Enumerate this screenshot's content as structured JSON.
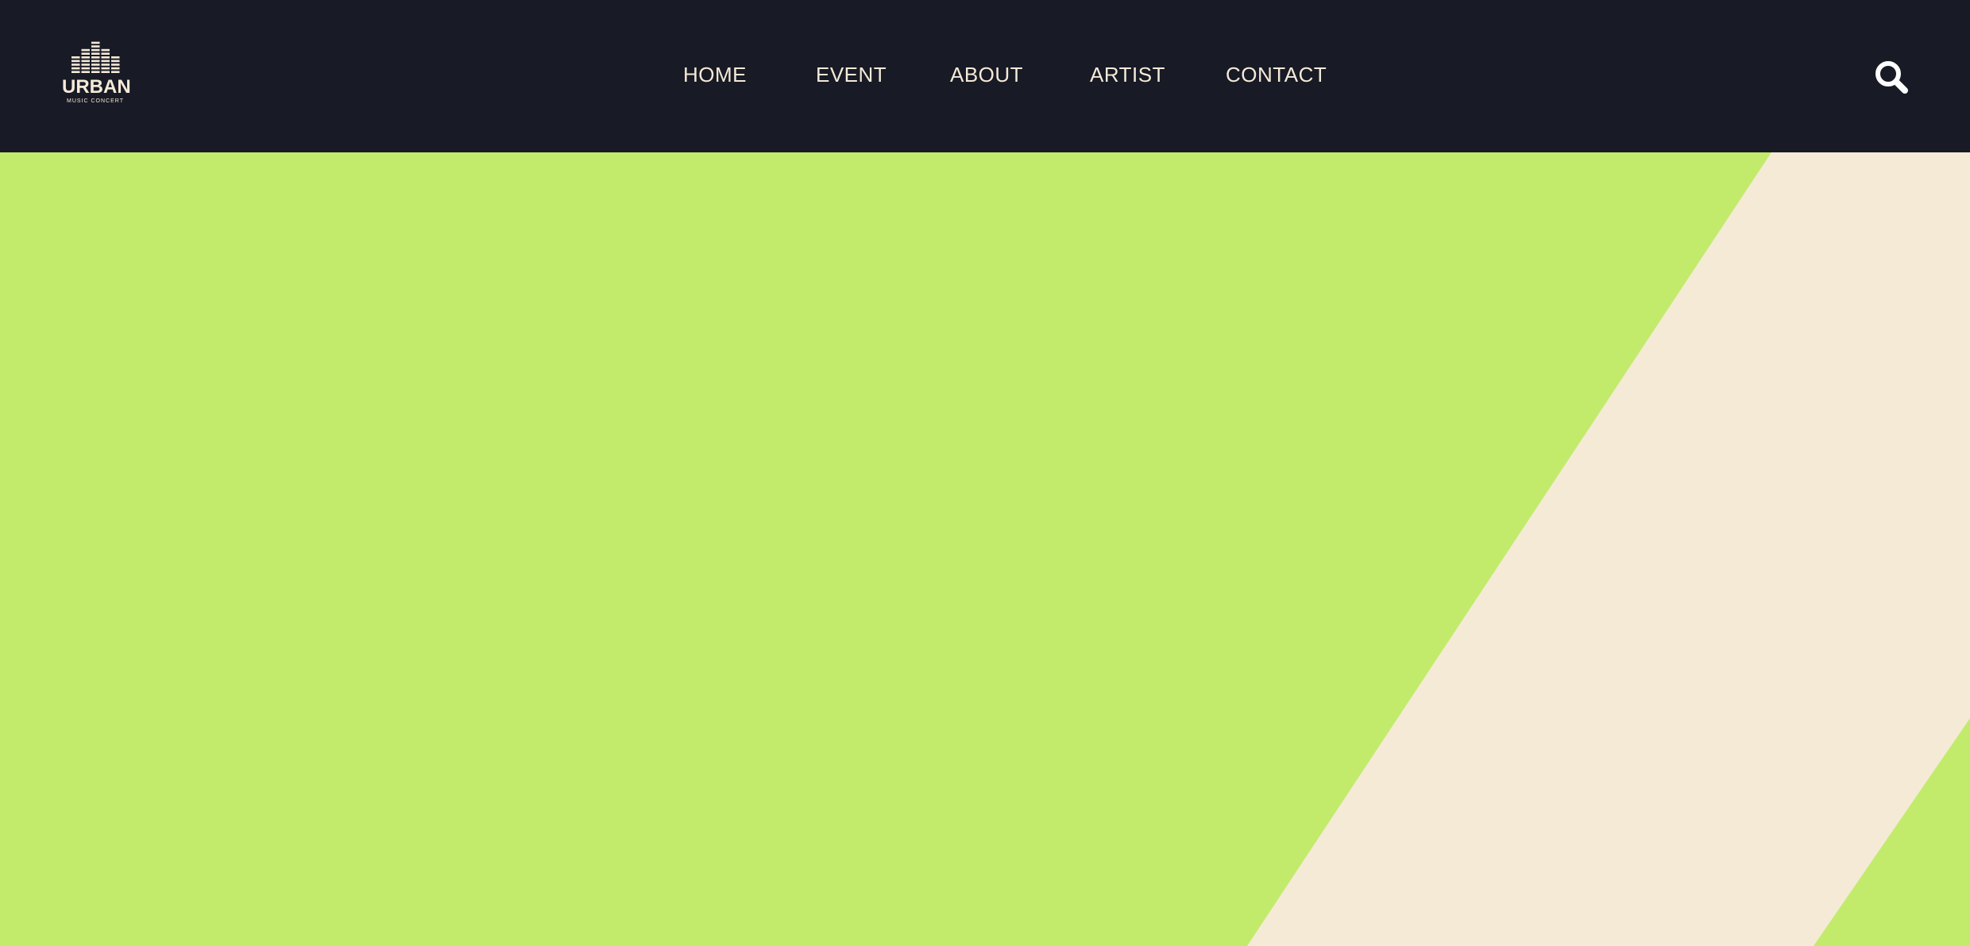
{
  "logo": {
    "title": "URBAN",
    "subtitle": "MUSIC CONCERT"
  },
  "nav": {
    "items": [
      {
        "label": "HOME"
      },
      {
        "label": "EVENT"
      },
      {
        "label": "ABOUT"
      },
      {
        "label": "ARTIST"
      },
      {
        "label": "CONTACT"
      }
    ]
  },
  "search": {
    "icon": "search-icon"
  },
  "colors": {
    "navbar_bg": "#181a25",
    "nav_text": "#f5ead8",
    "hero_green": "#c2eb6c",
    "hero_stripe": "#f5ead6",
    "icon_white": "#ffffff"
  }
}
